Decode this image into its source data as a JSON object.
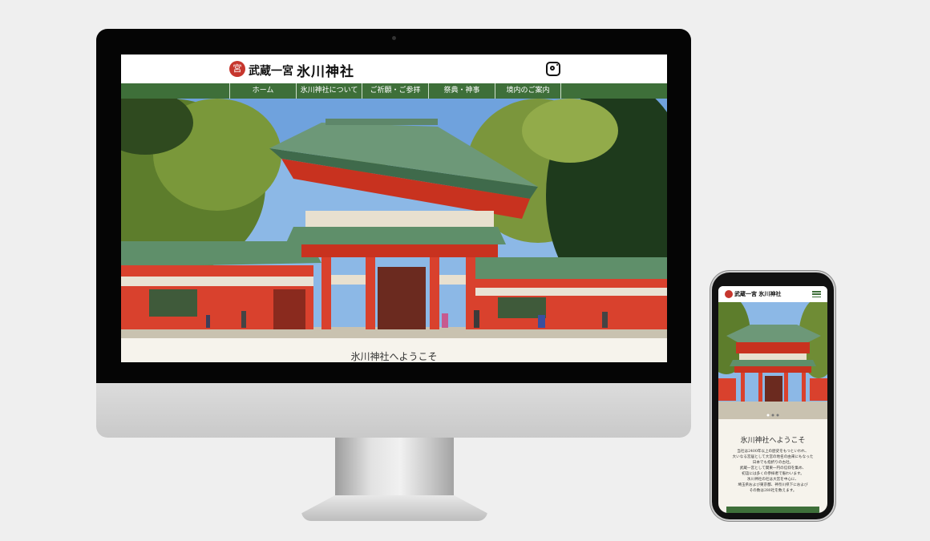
{
  "desktop": {
    "logo_prefix": "武蔵一宮",
    "logo_name": "氷川神社",
    "seal_char": "宮",
    "nav": [
      "ホーム",
      "氷川神社について",
      "ご祈願・ご参拝",
      "祭典・神事",
      "境内のご案内"
    ],
    "welcome_title": "氷川神社へようこそ",
    "icons": {
      "social": "instagram-icon"
    }
  },
  "mobile": {
    "logo": "武蔵一宮 氷川神社",
    "welcome_title": "氷川神社へようこそ",
    "intro_lines": [
      "当社は2400年以上の歴史をもつといわれ、",
      "大いなる宮居として大宮の地名の由来にもなった",
      "日本でも指折りの古社。",
      "武蔵一宮として関東一円の信仰を集め、",
      "初詣には多くの参拝者で賑わいます。",
      "氷川神社の社は大宮を中心に、",
      "埼玉県および東京都、神奈川県下におよび",
      "その数は280社を数えます。"
    ],
    "icons": {
      "menu": "hamburger-menu-icon"
    }
  },
  "colors": {
    "nav_green": "#3e6f39",
    "shrine_red": "#d9412d",
    "roof_green": "#5f8f6a",
    "background": "#efefef"
  }
}
